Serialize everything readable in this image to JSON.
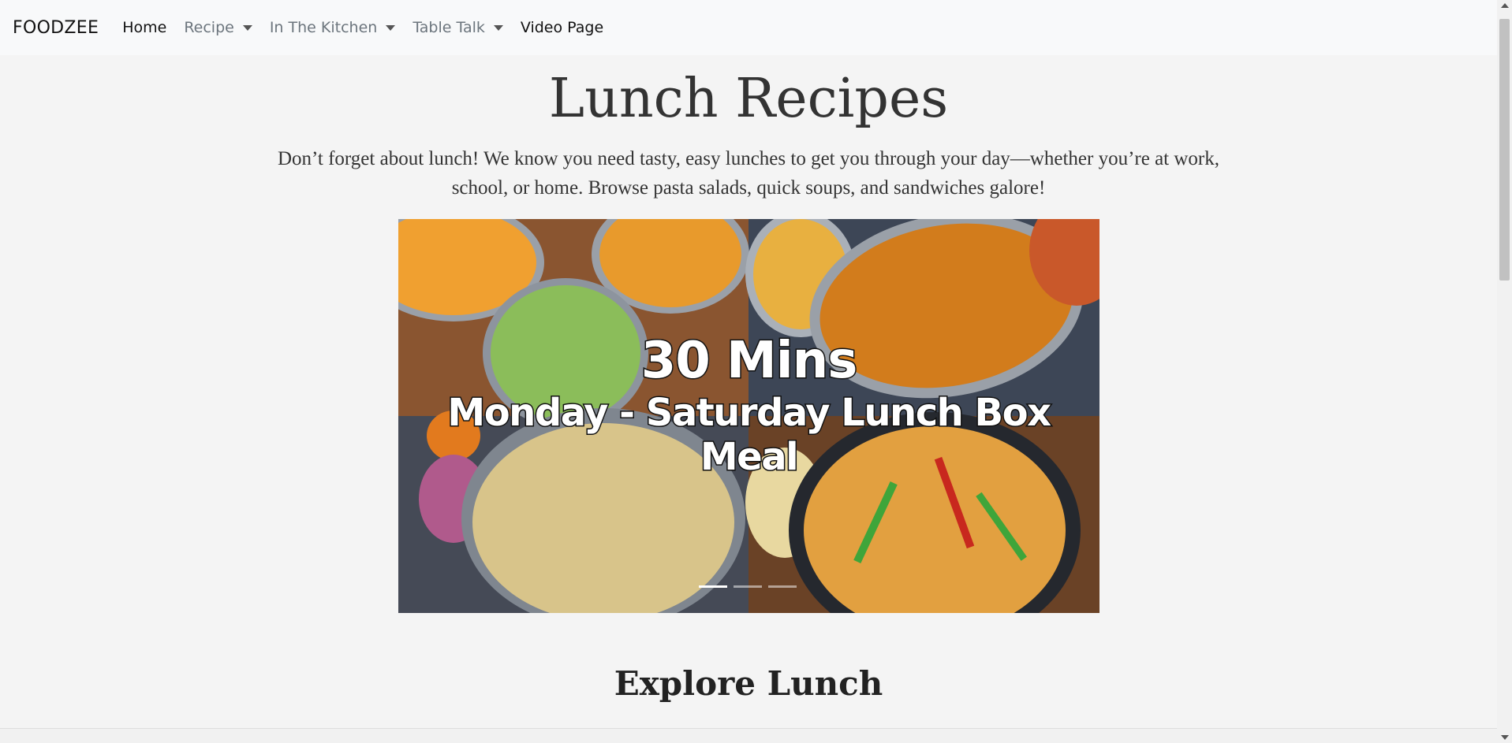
{
  "nav": {
    "brand": "FOODZEE",
    "items": [
      {
        "label": "Home",
        "dropdown": false,
        "active": true
      },
      {
        "label": "Recipe",
        "dropdown": true,
        "active": false
      },
      {
        "label": "In The Kitchen",
        "dropdown": true,
        "active": false
      },
      {
        "label": "Table Talk",
        "dropdown": true,
        "active": false
      },
      {
        "label": "Video Page",
        "dropdown": false,
        "active": true
      }
    ]
  },
  "main": {
    "title": "Lunch Recipes",
    "intro": "Don’t forget about lunch! We know you need tasty, easy lunches to get you through your day—whether you’re at work, school, or home. Browse pasta salads, quick soups, and sandwiches galore!",
    "carousel": {
      "caption_main": "30 Mins",
      "caption_sub": "Monday - Saturday Lunch Box Meal",
      "slides": 3,
      "active_slide": 1
    },
    "section_heading": "Explore Lunch"
  },
  "colors": {
    "page_bg": "#f4f4f4",
    "navbar_bg": "#f8f9fa",
    "text_dark": "#333333",
    "nav_muted": "#6c757d"
  }
}
